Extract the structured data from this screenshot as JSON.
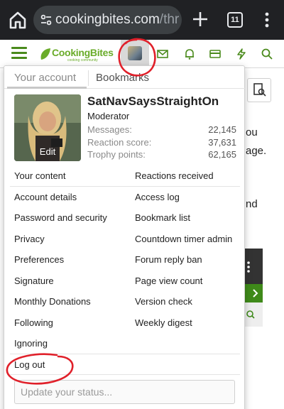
{
  "browser": {
    "url_main": "cookingbites.com",
    "url_rest": "/thr",
    "tab_count": "11"
  },
  "site": {
    "logo_text": "CookingBites",
    "logo_tagline": "cooking community"
  },
  "dropdown": {
    "tabs": [
      "Your account",
      "Bookmarks"
    ],
    "user": {
      "name": "SatNavSaysStraightOn",
      "role": "Moderator",
      "edit_label": "Edit",
      "stats": [
        {
          "label": "Messages:",
          "value": "22,145"
        },
        {
          "label": "Reaction score:",
          "value": "37,631"
        },
        {
          "label": "Trophy points:",
          "value": "62,165"
        }
      ]
    },
    "links": {
      "your_content": "Your content",
      "reactions_received": "Reactions received",
      "account_details": "Account details",
      "access_log": "Access log",
      "password_security": "Password and security",
      "bookmark_list": "Bookmark list",
      "privacy": "Privacy",
      "countdown_timer_admin": "Countdown timer admin",
      "preferences": "Preferences",
      "forum_reply_ban": "Forum reply ban",
      "signature": "Signature",
      "page_view_count": "Page view count",
      "monthly_donations": "Monthly Donations",
      "version_check": "Version check",
      "following": "Following",
      "weekly_digest": "Weekly digest",
      "ignoring": "Ignoring",
      "log_out": "Log out"
    },
    "status_placeholder": "Update your status..."
  },
  "background": {
    "text_line_1": "ou",
    "text_line_2": "age.",
    "text_line_3": "nd"
  },
  "colors": {
    "brand_green": "#6aac2a",
    "annotation_red": "#e0202a",
    "chrome_dark": "#202124"
  }
}
